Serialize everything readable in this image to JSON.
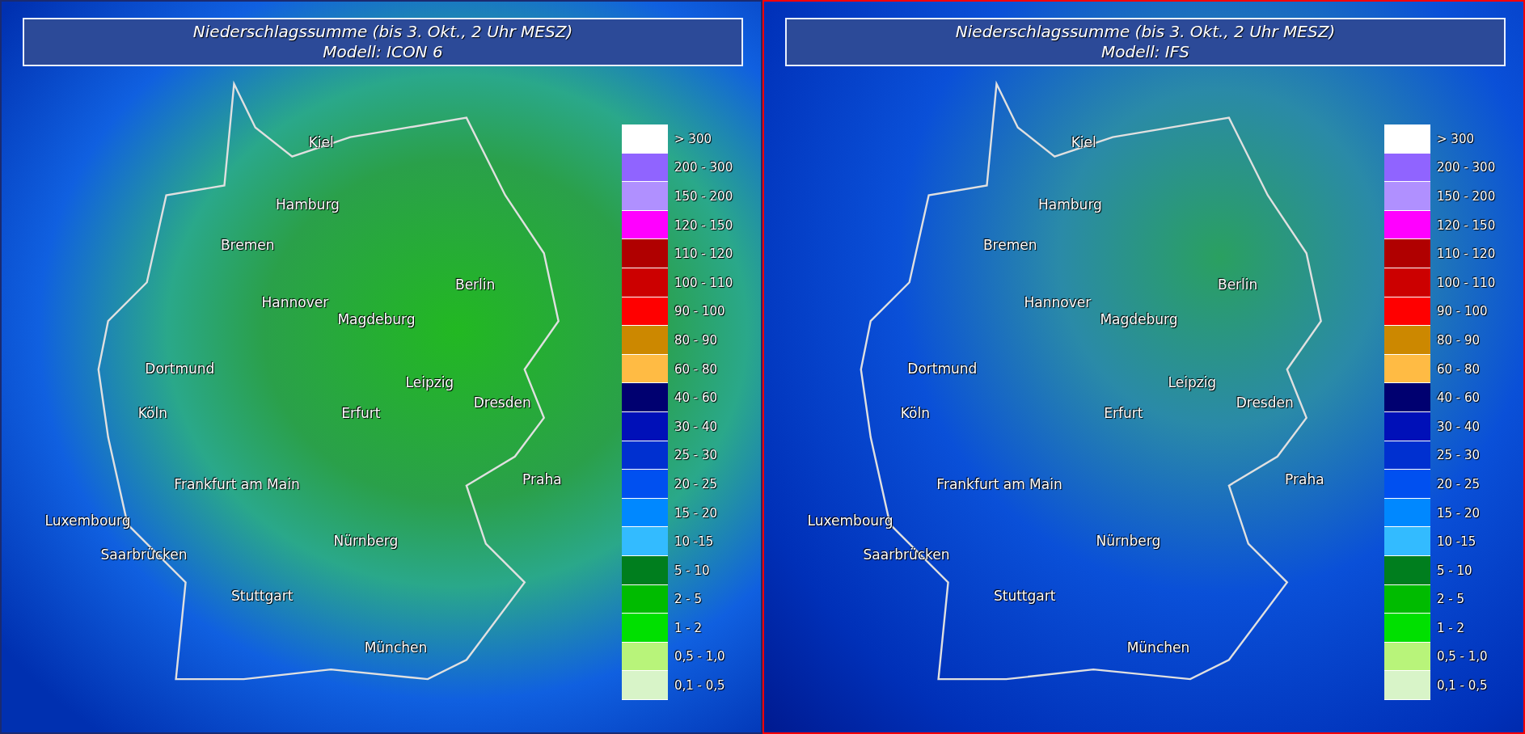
{
  "panels": [
    {
      "title": "Niederschlagssumme (bis 3. Okt., 2 Uhr MESZ)",
      "model": "Modell: ICON 6",
      "selected": false,
      "cities": [
        "Kiel",
        "Hamburg",
        "Bremen",
        "Hannover",
        "Magdeburg",
        "Berlin",
        "Dortmund",
        "Leipzig",
        "Dresden",
        "Köln",
        "Erfurt",
        "Praha",
        "Frankfurt am Main",
        "Luxembourg",
        "Saarbrücken",
        "Nürnberg",
        "Stuttgart",
        "München"
      ],
      "legend": [
        {
          "label": "> 300",
          "color": "#ffffff"
        },
        {
          "label": "200 - 300",
          "color": "#9064ff"
        },
        {
          "label": "150 - 200",
          "color": "#b090ff"
        },
        {
          "label": "120 - 150",
          "color": "#ff00ff"
        },
        {
          "label": "110 - 120",
          "color": "#b00000"
        },
        {
          "label": "100 - 110",
          "color": "#cc0000"
        },
        {
          "label": "90 - 100",
          "color": "#ff0000"
        },
        {
          "label": "80 - 90",
          "color": "#cc8800"
        },
        {
          "label": "60 - 80",
          "color": "#ffbb44"
        },
        {
          "label": "40 - 60",
          "color": "#000070"
        },
        {
          "label": "30 - 40",
          "color": "#0010b8"
        },
        {
          "label": "25 - 30",
          "color": "#0030d0"
        },
        {
          "label": "20 - 25",
          "color": "#0050f0"
        },
        {
          "label": "15 - 20",
          "color": "#0088ff"
        },
        {
          "label": "10 -15",
          "color": "#33bbff"
        },
        {
          "label": "5 - 10",
          "color": "#007e1e"
        },
        {
          "label": "2 - 5",
          "color": "#00bb00"
        },
        {
          "label": "1 - 2",
          "color": "#00e000"
        },
        {
          "label": "0,5 - 1,0",
          "color": "#b8f47a"
        },
        {
          "label": "0,1 - 0,5",
          "color": "#d8f4c8"
        }
      ]
    },
    {
      "title": "Niederschlagssumme (bis 3. Okt., 2 Uhr MESZ)",
      "model": "Modell: IFS",
      "selected": true,
      "cities": [
        "Kiel",
        "Hamburg",
        "Bremen",
        "Hannover",
        "Magdeburg",
        "Berlin",
        "Dortmund",
        "Leipzig",
        "Dresden",
        "Köln",
        "Erfurt",
        "Praha",
        "Frankfurt am Main",
        "Luxembourg",
        "Saarbrücken",
        "Nürnberg",
        "Stuttgart",
        "München"
      ],
      "legend": [
        {
          "label": "> 300",
          "color": "#ffffff"
        },
        {
          "label": "200 - 300",
          "color": "#9064ff"
        },
        {
          "label": "150 - 200",
          "color": "#b090ff"
        },
        {
          "label": "120 - 150",
          "color": "#ff00ff"
        },
        {
          "label": "110 - 120",
          "color": "#b00000"
        },
        {
          "label": "100 - 110",
          "color": "#cc0000"
        },
        {
          "label": "90 - 100",
          "color": "#ff0000"
        },
        {
          "label": "80 - 90",
          "color": "#cc8800"
        },
        {
          "label": "60 - 80",
          "color": "#ffbb44"
        },
        {
          "label": "40 - 60",
          "color": "#000070"
        },
        {
          "label": "30 - 40",
          "color": "#0010b8"
        },
        {
          "label": "25 - 30",
          "color": "#0030d0"
        },
        {
          "label": "20 - 25",
          "color": "#0050f0"
        },
        {
          "label": "15 - 20",
          "color": "#0088ff"
        },
        {
          "label": "10 -15",
          "color": "#33bbff"
        },
        {
          "label": "5 - 10",
          "color": "#007e1e"
        },
        {
          "label": "2 - 5",
          "color": "#00bb00"
        },
        {
          "label": "1 - 2",
          "color": "#00e000"
        },
        {
          "label": "0,5 - 1,0",
          "color": "#b8f47a"
        },
        {
          "label": "0,1 - 0,5",
          "color": "#d8f4c8"
        }
      ]
    }
  ]
}
